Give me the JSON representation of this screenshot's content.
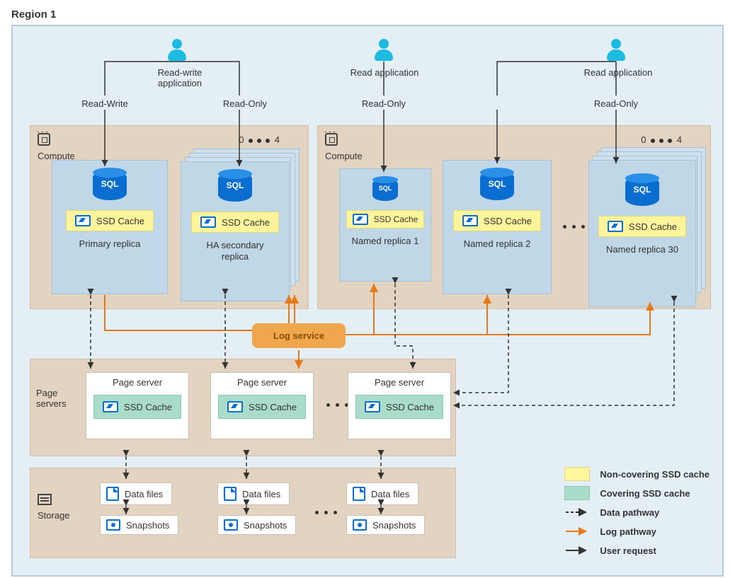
{
  "region": {
    "title": "Region 1"
  },
  "users": {
    "rw": {
      "label": "Read-write\napplication",
      "left": "Read-Write",
      "right": "Read-Only"
    },
    "r1": {
      "label": "Read application",
      "line": "Read-Only"
    },
    "r2": {
      "label": "Read application",
      "line": "Read-Only"
    }
  },
  "compute": {
    "label": "Compute",
    "left": {
      "range": {
        "from": "0",
        "to": "4"
      },
      "primary": {
        "title": "Primary replica",
        "ssd": "SSD Cache"
      },
      "ha": {
        "title": "HA secondary\nreplica",
        "ssd": "SSD Cache"
      }
    },
    "right": {
      "range": {
        "from": "0",
        "to": "4"
      },
      "r1": {
        "title": "Named replica 1",
        "ssd": "SSD Cache"
      },
      "r2": {
        "title": "Named replica 2",
        "ssd": "SSD Cache"
      },
      "r30": {
        "title": "Named replica 30",
        "ssd": "SSD Cache"
      }
    }
  },
  "log": {
    "label": "Log service"
  },
  "page": {
    "side_label": "Page\nservers",
    "title": "Page server",
    "ssd": "SSD Cache"
  },
  "storage": {
    "side_label": "Storage",
    "data": "Data files",
    "snap": "Snapshots"
  },
  "legend": {
    "noncov": "Non-covering SSD cache",
    "cov": "Covering SSD cache",
    "data": "Data pathway",
    "log": "Log pathway",
    "user": "User request"
  }
}
